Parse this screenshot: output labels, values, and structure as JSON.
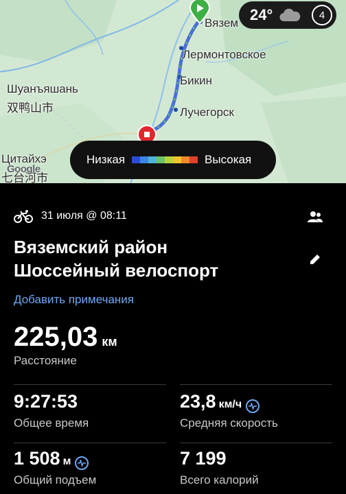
{
  "map": {
    "labels": {
      "vyazem": "Вязем",
      "lermontovskoe": "Лермонтовское",
      "bikin": "Бикин",
      "luchegorsk": "Лучегорск",
      "shuanyashan_ru": "Шуанъяшань",
      "shuanyashan_cn": "双鸭山市",
      "citaihe_ru": "Цитайхэ",
      "citaihe_cn": "七台河市"
    },
    "google_logo": "Google",
    "weather": {
      "temp": "24°",
      "badge": "4",
      "icon": "cloud-icon"
    },
    "legend": {
      "low": "Низкая",
      "high": "Высокая",
      "colors": [
        "#2a4bd8",
        "#3a86e0",
        "#4fb3d9",
        "#6cc36b",
        "#b7d43c",
        "#f0c431",
        "#f08a2a",
        "#e0412c"
      ]
    },
    "route_color": "#4a6fd8",
    "start_pin_color": "#3cb043",
    "end_pin_color": "#e0262e"
  },
  "activity": {
    "date": "31 июля @ 08:11",
    "title_line1": "Вяземский район",
    "title_line2": "Шоссейный велоспорт",
    "add_notes": "Добавить примечания",
    "distance": {
      "value": "225,03",
      "unit": "км",
      "label": "Расстояние"
    },
    "total_time": {
      "value": "9:27:53",
      "label": "Общее время"
    },
    "avg_speed": {
      "value": "23,8",
      "unit": "км/ч",
      "label": "Средняя скорость"
    },
    "elevation": {
      "value": "1 508",
      "unit": "м",
      "label": "Общий подъем"
    },
    "calories": {
      "value": "7 199",
      "label": "Всего калорий"
    }
  }
}
